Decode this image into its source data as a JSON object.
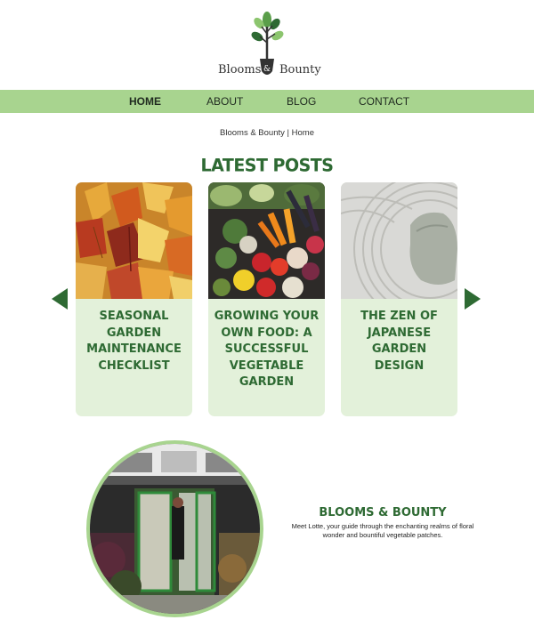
{
  "brand": {
    "logo_text_left": "Blooms",
    "logo_text_right": "Bounty",
    "logo_ampersand": "&"
  },
  "nav": {
    "items": [
      {
        "label": "HOME",
        "active": true
      },
      {
        "label": "ABOUT",
        "active": false
      },
      {
        "label": "BLOG",
        "active": false
      },
      {
        "label": "CONTACT",
        "active": false
      }
    ]
  },
  "breadcrumb": "Blooms & Bounty | Home",
  "latest": {
    "title": "LATEST POSTS",
    "posts": [
      {
        "title": "SEASONAL GARDEN MAINTENANCE CHECKLIST",
        "image": "autumn-leaves"
      },
      {
        "title": "GROWING YOUR OWN FOOD: A SUCCESSFUL VEGETABLE GARDEN",
        "image": "vegetables"
      },
      {
        "title": "THE ZEN OF JAPANESE GARDEN DESIGN",
        "image": "zen-gravel"
      }
    ]
  },
  "about": {
    "title": "BLOOMS & BOUNTY",
    "text": "Meet Lotte, your guide through the enchanting realms of floral wonder and bountiful vegetable patches."
  },
  "colors": {
    "brand_green": "#2e6a33",
    "nav_green": "#a8d48f",
    "card_bg": "#e3f1da"
  }
}
